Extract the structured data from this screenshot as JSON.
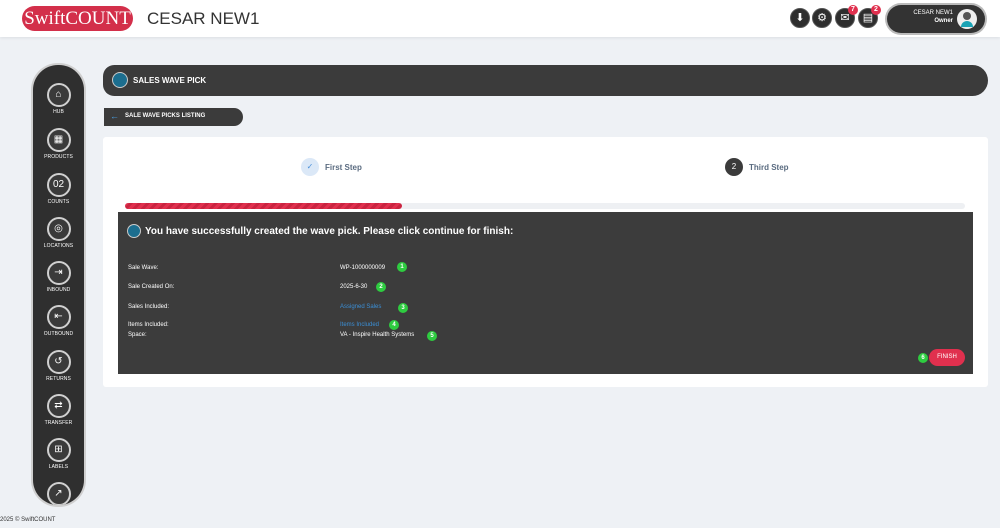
{
  "topbar": {
    "logo": "SwiftCOUNT",
    "company": "CESAR NEW1",
    "icons": [
      {
        "name": "download-icon",
        "glyph": "⬇",
        "badge": ""
      },
      {
        "name": "settings-icon",
        "glyph": "⚙",
        "badge": ""
      },
      {
        "name": "notifications-icon",
        "glyph": "✉",
        "badge": "7"
      },
      {
        "name": "tasks-icon",
        "glyph": "▤",
        "badge": "2"
      }
    ],
    "user": {
      "name": "CESAR NEW1",
      "role": "Owner"
    }
  },
  "sidebar": {
    "items": [
      {
        "label": "HUB",
        "icon": "hub-icon",
        "glyph": "⌂"
      },
      {
        "label": "PRODUCTS",
        "icon": "products-icon",
        "glyph": "▦"
      },
      {
        "label": "COUNTS",
        "icon": "counts-icon",
        "glyph": "02"
      },
      {
        "label": "LOCATIONS",
        "icon": "locations-icon",
        "glyph": "◎"
      },
      {
        "label": "INBOUND",
        "icon": "inbound-icon",
        "glyph": "⇥"
      },
      {
        "label": "OUTBOUND",
        "icon": "outbound-icon",
        "glyph": "⇤"
      },
      {
        "label": "RETURNS",
        "icon": "returns-icon",
        "glyph": "↺"
      },
      {
        "label": "TRANSFER",
        "icon": "transfer-icon",
        "glyph": "⇄"
      },
      {
        "label": "LABELS",
        "icon": "labels-icon",
        "glyph": "⊞"
      },
      {
        "label": "",
        "icon": "reports-icon",
        "glyph": "↗"
      }
    ]
  },
  "header": {
    "title": "SALES WAVE PICK"
  },
  "back": {
    "label": "SALE WAVE PICKS LISTING"
  },
  "steps": {
    "first": {
      "label": "First Step",
      "mark": "✓"
    },
    "third": {
      "label": "Third Step",
      "mark": "2"
    }
  },
  "progress": {
    "fraction": 0.33
  },
  "panel": {
    "message": "You have successfully created the wave pick. Please click continue for finish:",
    "rows": {
      "sale_wave": {
        "label": "Sale Wave:",
        "value": "WP-1000000009",
        "num": "1"
      },
      "created_on": {
        "label": "Sale Created On:",
        "value": "2025-6-30",
        "num": "2"
      },
      "sales_included": {
        "label": "Sales Included:",
        "value": "Assigned Sales",
        "num": "3"
      },
      "items_included": {
        "label": "Items Included:",
        "value": "Items Included",
        "num": "4"
      },
      "space": {
        "label": "Space:",
        "value": "VA - Inspire Health Systems",
        "num": "5"
      }
    },
    "finish": {
      "label": "FINISH",
      "num": "6"
    }
  },
  "footer": {
    "text": "2025 © SwiftCOUNT"
  }
}
